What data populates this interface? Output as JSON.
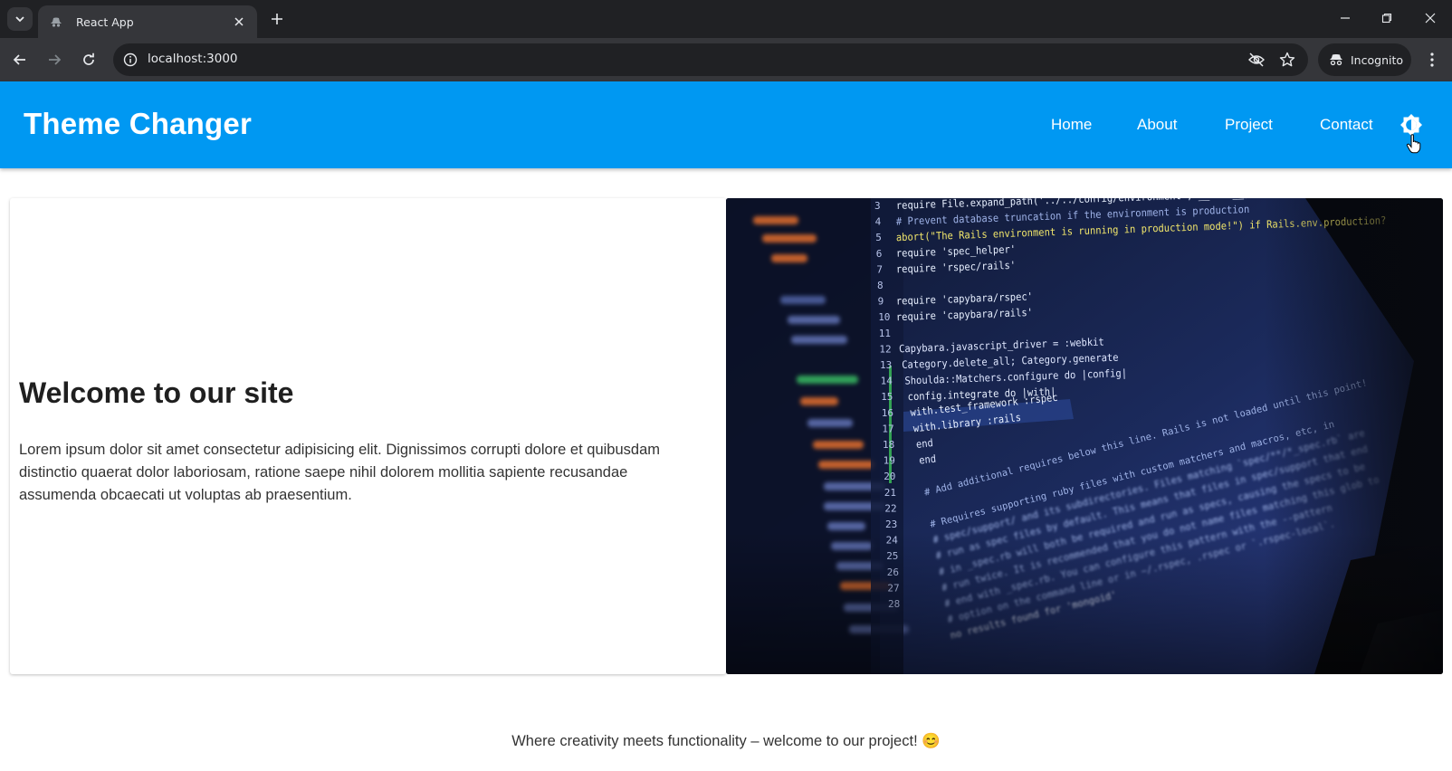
{
  "browser": {
    "tab_title": "React App",
    "url": "localhost:3000",
    "incognito_label": "Incognito"
  },
  "site": {
    "brand": "Theme Changer",
    "nav": [
      {
        "label": "Home"
      },
      {
        "label": "About"
      },
      {
        "label": "Project"
      },
      {
        "label": "Contact"
      }
    ],
    "theme_toggle_icon": "brightness-icon",
    "header_color": "#0098f2"
  },
  "hero": {
    "title": "Welcome to our site",
    "text": "Lorem ipsum dolor sit amet consectetur adipisicing elit. Dignissimos corrupti dolore et quibusdam distinctio quaerat dolor laboriosam, ratione saepe nihil dolorem mollitia sapiente recusandae assumenda obcaecati ut voluptas ab praesentium.",
    "image_subject": "laptop screen with code editor",
    "code_lines": [
      {
        "num": "3",
        "text": "require File.expand_path('../../config/environment', __FILE__)"
      },
      {
        "num": "4",
        "text": "# Prevent database truncation if the environment is production"
      },
      {
        "num": "5",
        "text": "abort(\"The Rails environment is running in production mode!\") if Rails.env.production?"
      },
      {
        "num": "6",
        "text": "require 'spec_helper'"
      },
      {
        "num": "7",
        "text": "require 'rspec/rails'"
      },
      {
        "num": "8",
        "text": ""
      },
      {
        "num": "9",
        "text": "require 'capybara/rspec'"
      },
      {
        "num": "10",
        "text": "require 'capybara/rails'"
      },
      {
        "num": "11",
        "text": ""
      },
      {
        "num": "12",
        "text": "Capybara.javascript_driver = :webkit"
      },
      {
        "num": "13",
        "text": "Category.delete_all; Category.generate"
      },
      {
        "num": "14",
        "text": "Shoulda::Matchers.configure do |config|"
      },
      {
        "num": "15",
        "text": "config.integrate do |with|"
      },
      {
        "num": "16",
        "text": "with.test_framework :rspec"
      },
      {
        "num": "17",
        "text": "with.library :rails"
      },
      {
        "num": "18",
        "text": "end"
      },
      {
        "num": "19",
        "text": "end"
      },
      {
        "num": "20",
        "text": ""
      },
      {
        "num": "21",
        "text": "# Add additional requires below this line. Rails is not loaded until this point!"
      },
      {
        "num": "22",
        "text": ""
      },
      {
        "num": "23",
        "text": "# Requires supporting ruby files with custom matchers and macros, etc, in"
      },
      {
        "num": "24",
        "text": "# spec/support/ and its subdirectories. Files matching `spec/**/*_spec.rb` are"
      },
      {
        "num": "25",
        "text": "# run as spec files by default. This means that files in spec/support that end"
      },
      {
        "num": "26",
        "text": "# in _spec.rb will both be required and run as specs, causing the specs to be"
      },
      {
        "num": "27",
        "text": "# run twice. It is recommended that you do not name files matching this glob to"
      },
      {
        "num": "28",
        "text": "# end with _spec.rb. You can configure this pattern with the --pattern"
      },
      {
        "num": "",
        "text": "# option on the command line or in ~/.rspec, .rspec or `.rspec-local`."
      },
      {
        "num": "",
        "text": "no results found for 'mongoid'"
      }
    ]
  },
  "footer": {
    "tagline": "Where creativity meets functionality – welcome to our project! 😊"
  }
}
